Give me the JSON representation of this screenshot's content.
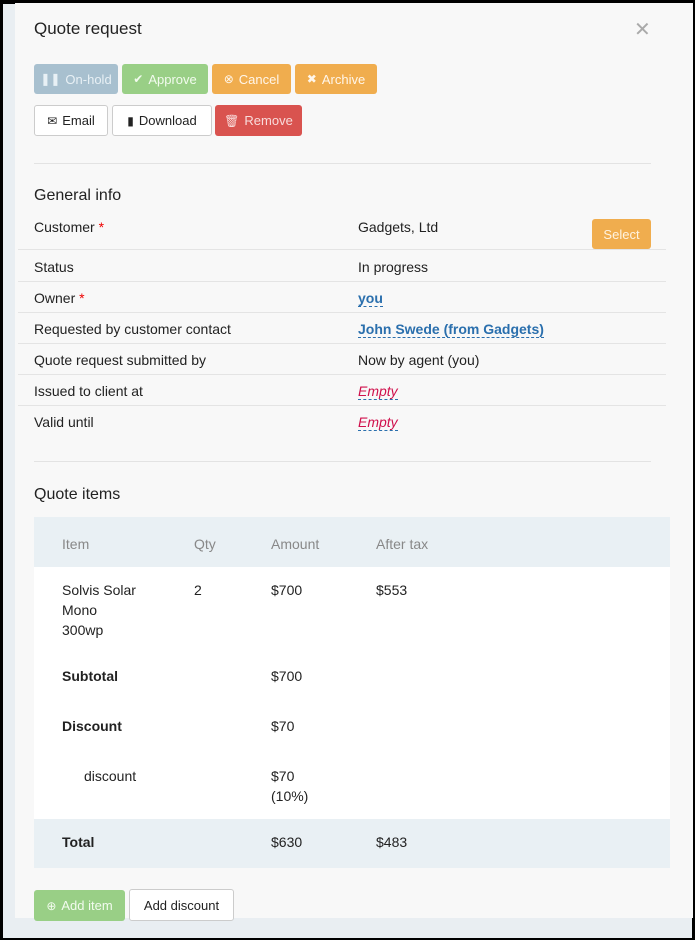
{
  "modal": {
    "title": "Quote request",
    "close_icon": "close-icon"
  },
  "actions": {
    "onhold": "On-hold",
    "approve": "Approve",
    "cancel": "Cancel",
    "archive": "Archive",
    "email": "Email",
    "download": "Download",
    "remove": "Remove"
  },
  "general": {
    "heading": "General info",
    "select_label": "Select",
    "rows": [
      {
        "label": "Customer",
        "required": "*",
        "value": "Gadgets, Ltd"
      },
      {
        "label": "Status",
        "value": "In progress"
      },
      {
        "label": "Owner",
        "required": "*",
        "value": "you"
      },
      {
        "label": "Requested by customer contact",
        "value": "John Swede (from Gadgets)"
      },
      {
        "label": "Quote request submitted by",
        "value": "Now by agent (you)"
      },
      {
        "label": "Issued to client at",
        "value": "Empty"
      },
      {
        "label": "Valid until",
        "value": "Empty"
      }
    ]
  },
  "items": {
    "heading": "Quote items",
    "columns": [
      "Item",
      "Qty",
      "Amount",
      "After tax"
    ],
    "rows": [
      {
        "item_line1": "Solvis Solar",
        "item_line2": "Mono",
        "item_line3": "300wp",
        "qty": "2",
        "amount": "$700",
        "after_tax": "$553"
      }
    ],
    "subtotal": {
      "label": "Subtotal",
      "amount": "$700"
    },
    "discount": {
      "label": "Discount",
      "amount": "$70"
    },
    "discount_line": {
      "label": "discount",
      "amount": "$70",
      "percent": "(10%)"
    },
    "total": {
      "label": "Total",
      "amount": "$630",
      "after_tax": "$483"
    },
    "add_item": "Add item",
    "add_discount": "Add discount"
  }
}
